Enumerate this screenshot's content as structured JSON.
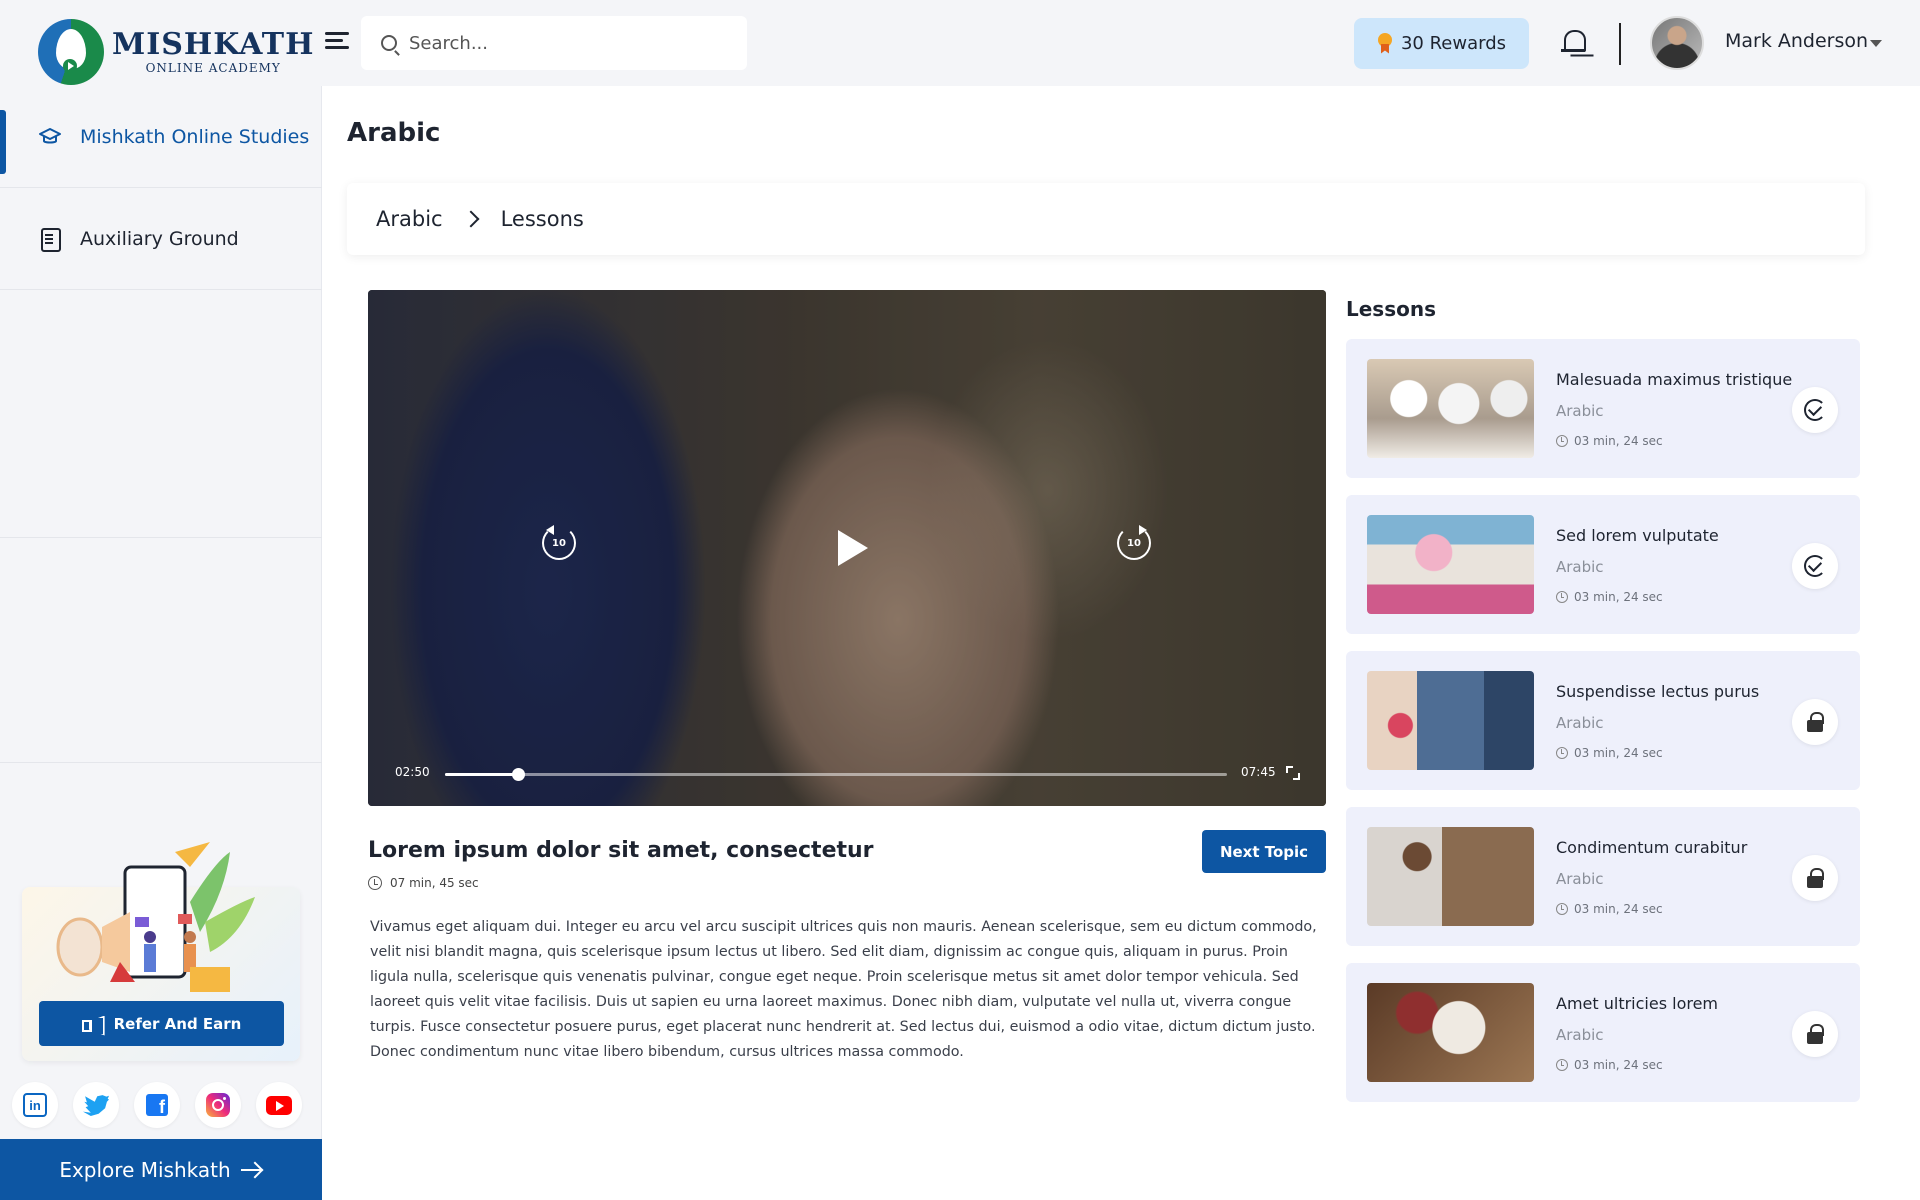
{
  "brand": {
    "name": "MISHKATH",
    "tagline": "ONLINE ACADEMY"
  },
  "header": {
    "search_placeholder": "Search...",
    "rewards_label": "30 Rewards",
    "user_name": "Mark Anderson"
  },
  "sidebar": {
    "items": [
      {
        "label": "Mishkath Online Studies",
        "icon": "graduation-cap-icon",
        "active": true
      },
      {
        "label": "Auxiliary Ground",
        "icon": "document-icon",
        "active": false
      }
    ],
    "refer_label": "Refer And Earn",
    "socials": [
      "linkedin-icon",
      "twitter-icon",
      "facebook-icon",
      "instagram-icon",
      "youtube-icon"
    ],
    "explore_label": "Explore Mishkath"
  },
  "main": {
    "page_title": "Arabic",
    "breadcrumb": [
      "Arabic",
      "Lessons"
    ],
    "video": {
      "current_time": "02:50",
      "duration": "07:45",
      "progress": 0.0935,
      "skip_seconds": "10"
    },
    "lesson": {
      "title": "Lorem ipsum dolor sit amet, consectetur",
      "duration": "07 min, 45 sec",
      "next_label": "Next Topic",
      "description": "Vivamus eget aliquam dui. Integer eu arcu vel arcu suscipit ultrices quis non mauris. Aenean scelerisque, sem eu dictum commodo, velit nisi blandit magna, quis scelerisque ipsum lectus ut libero. Sed elit diam, dignissim ac congue quis, aliquam in purus. Proin ligula nulla, scelerisque quis venenatis pulvinar, congue eget neque. Proin scelerisque metus sit amet dolor tempor vehicula. Sed laoreet quis velit vitae facilisis. Duis ut sapien eu urna laoreet maximus. Donec nibh diam, vulputate vel nulla ut, viverra congue turpis. Fusce consectetur posuere purus, eget placerat nunc hendrerit at. Sed lectus dui, euismod a odio vitae, dictum dictum justo. Donec condimentum nunc vitae libero bibendum, cursus ultrices massa commodo."
    }
  },
  "lessons_panel": {
    "heading": "Lessons",
    "items": [
      {
        "title": "Malesuada maximus tristique",
        "subject": "Arabic",
        "duration": "03 min, 24 sec",
        "status": "completed"
      },
      {
        "title": "Sed lorem vulputate",
        "subject": "Arabic",
        "duration": "03 min, 24 sec",
        "status": "completed"
      },
      {
        "title": "Suspendisse lectus purus",
        "subject": "Arabic",
        "duration": "03 min, 24 sec",
        "status": "locked"
      },
      {
        "title": "Condimentum curabitur",
        "subject": "Arabic",
        "duration": "03 min, 24 sec",
        "status": "locked"
      },
      {
        "title": "Amet ultricies lorem",
        "subject": "Arabic",
        "duration": "03 min, 24 sec",
        "status": "locked"
      }
    ]
  },
  "colors": {
    "primary": "#0d56a3",
    "rewards_bg": "#cde6fb",
    "card_bg": "#eef0fb",
    "sidebar_bg": "#f4f5f8"
  }
}
